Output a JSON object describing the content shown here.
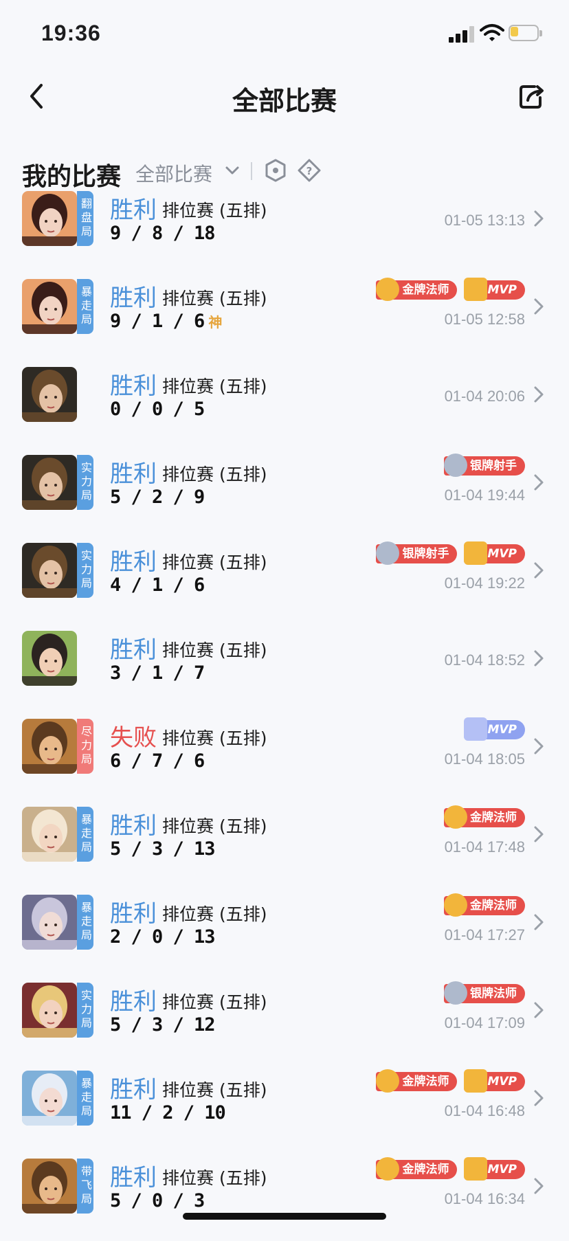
{
  "status": {
    "time": "19:36",
    "battery_level": 0.3
  },
  "nav": {
    "title": "全部比赛",
    "back_icon": "chevron-left-icon",
    "share_icon": "share-icon"
  },
  "section": {
    "title": "我的比赛",
    "filter_label": "全部比赛"
  },
  "colors": {
    "win": "#4a90d9",
    "lose": "#e6504f",
    "tag_blue": "#5a9fe0",
    "tag_red": "#f07a78",
    "badge_red": "#e64f4a",
    "gold": "#f2b53b"
  },
  "matches": [
    {
      "hero": "hero-1",
      "tag": "翻盘局",
      "tag_color": "blue",
      "result": "胜利",
      "mode": "排位赛 (五排)",
      "kda": "9/8/18",
      "god": "",
      "badges": [],
      "time": "01-05 13:13"
    },
    {
      "hero": "hero-1",
      "tag": "暴走局",
      "tag_color": "blue",
      "result": "胜利",
      "mode": "排位赛 (五排)",
      "kda": "9/1/6",
      "god": "神",
      "badges": [
        "金牌法师",
        "MVP"
      ],
      "time": "01-05 12:58"
    },
    {
      "hero": "hero-2",
      "tag": "",
      "tag_color": "",
      "result": "胜利",
      "mode": "排位赛 (五排)",
      "kda": "0/0/5",
      "god": "",
      "badges": [],
      "time": "01-04 20:06"
    },
    {
      "hero": "hero-2",
      "tag": "实力局",
      "tag_color": "blue",
      "result": "胜利",
      "mode": "排位赛 (五排)",
      "kda": "5/2/9",
      "god": "",
      "badges": [
        "银牌射手"
      ],
      "time": "01-04 19:44"
    },
    {
      "hero": "hero-2",
      "tag": "实力局",
      "tag_color": "blue",
      "result": "胜利",
      "mode": "排位赛 (五排)",
      "kda": "4/1/6",
      "god": "",
      "badges": [
        "银牌射手",
        "MVP"
      ],
      "time": "01-04 19:22"
    },
    {
      "hero": "hero-3",
      "tag": "",
      "tag_color": "",
      "result": "胜利",
      "mode": "排位赛 (五排)",
      "kda": "3/1/7",
      "god": "",
      "badges": [],
      "time": "01-04 18:52"
    },
    {
      "hero": "hero-4",
      "tag": "尽力局",
      "tag_color": "red",
      "result": "失败",
      "mode": "排位赛 (五排)",
      "kda": "6/7/6",
      "god": "",
      "badges": [
        "MVP-blue"
      ],
      "time": "01-04 18:05"
    },
    {
      "hero": "hero-5",
      "tag": "暴走局",
      "tag_color": "blue",
      "result": "胜利",
      "mode": "排位赛 (五排)",
      "kda": "5/3/13",
      "god": "",
      "badges": [
        "金牌法师"
      ],
      "time": "01-04 17:48"
    },
    {
      "hero": "hero-6",
      "tag": "暴走局",
      "tag_color": "blue",
      "result": "胜利",
      "mode": "排位赛 (五排)",
      "kda": "2/0/13",
      "god": "",
      "badges": [
        "金牌法师"
      ],
      "time": "01-04 17:27"
    },
    {
      "hero": "hero-7",
      "tag": "实力局",
      "tag_color": "blue",
      "result": "胜利",
      "mode": "排位赛 (五排)",
      "kda": "5/3/12",
      "god": "",
      "badges": [
        "银牌法师"
      ],
      "time": "01-04 17:09"
    },
    {
      "hero": "hero-8",
      "tag": "暴走局",
      "tag_color": "blue",
      "result": "胜利",
      "mode": "排位赛 (五排)",
      "kda": "11/2/10",
      "god": "",
      "badges": [
        "金牌法师",
        "MVP"
      ],
      "time": "01-04 16:48"
    },
    {
      "hero": "hero-4",
      "tag": "带飞局",
      "tag_color": "blue",
      "result": "胜利",
      "mode": "排位赛 (五排)",
      "kda": "5/0/3",
      "god": "",
      "badges": [
        "金牌法师",
        "MVP"
      ],
      "time": "01-04 16:34"
    }
  ]
}
